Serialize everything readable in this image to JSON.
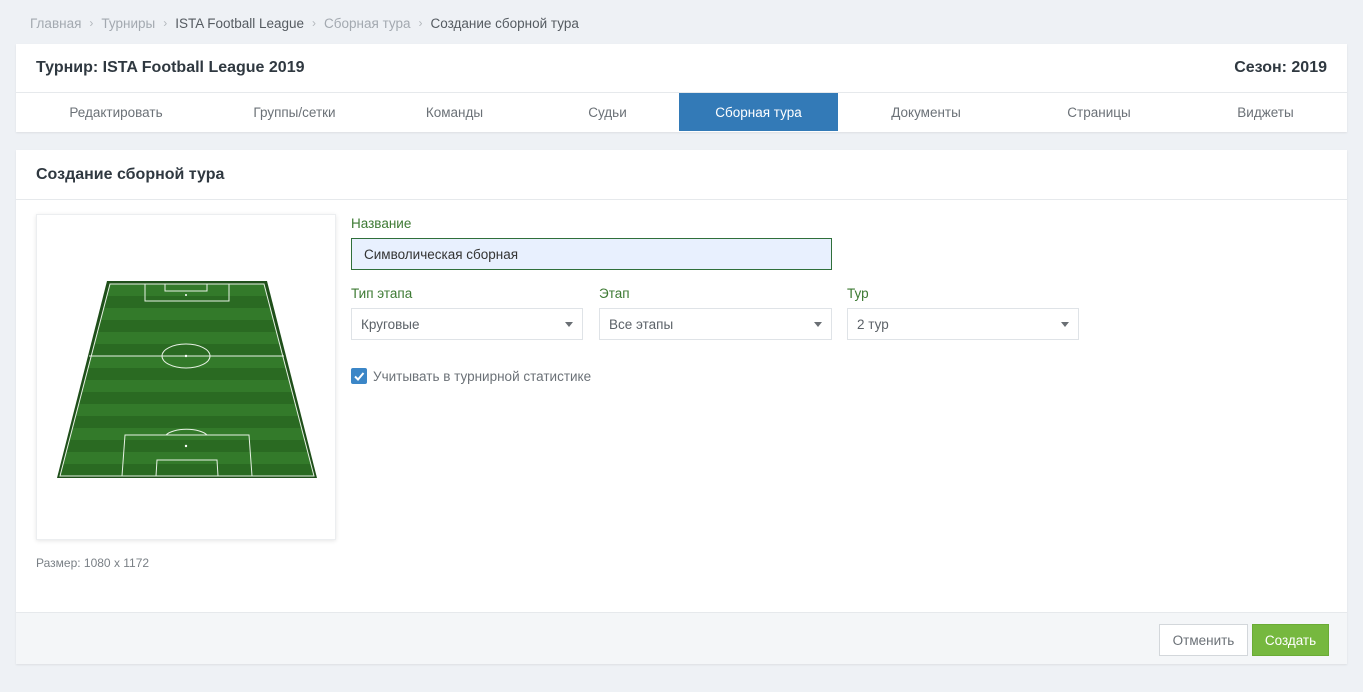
{
  "breadcrumb": [
    {
      "label": "Главная"
    },
    {
      "label": "Турниры"
    },
    {
      "label": "ISTA Football League"
    },
    {
      "label": "Сборная тура"
    },
    {
      "label": "Создание сборной тура"
    }
  ],
  "tournament": {
    "title": "Турнир: ISTA Football League 2019",
    "season": "Сезон: 2019"
  },
  "tabs": [
    {
      "label": "Редактировать"
    },
    {
      "label": "Группы/сетки"
    },
    {
      "label": "Команды"
    },
    {
      "label": "Судьи"
    },
    {
      "label": "Сборная тура",
      "active": true
    },
    {
      "label": "Документы"
    },
    {
      "label": "Страницы"
    },
    {
      "label": "Виджеты"
    }
  ],
  "panel": {
    "title": "Создание сборной тура",
    "image_size": "Размер: 1080 x 1172"
  },
  "form": {
    "name_label": "Название",
    "name_value": "Символическая сборная",
    "stage_type_label": "Тип этапа",
    "stage_type_value": "Круговые",
    "stage_label": "Этап",
    "stage_value": "Все этапы",
    "round_label": "Тур",
    "round_value": "2 тур",
    "stats_checkbox_label": "Учитывать в турнирной статистике",
    "stats_checked": true
  },
  "buttons": {
    "cancel": "Отменить",
    "create": "Создать"
  },
  "colors": {
    "accent": "#337ab7",
    "success": "#76b83f",
    "field_green": "#2a6a22"
  }
}
